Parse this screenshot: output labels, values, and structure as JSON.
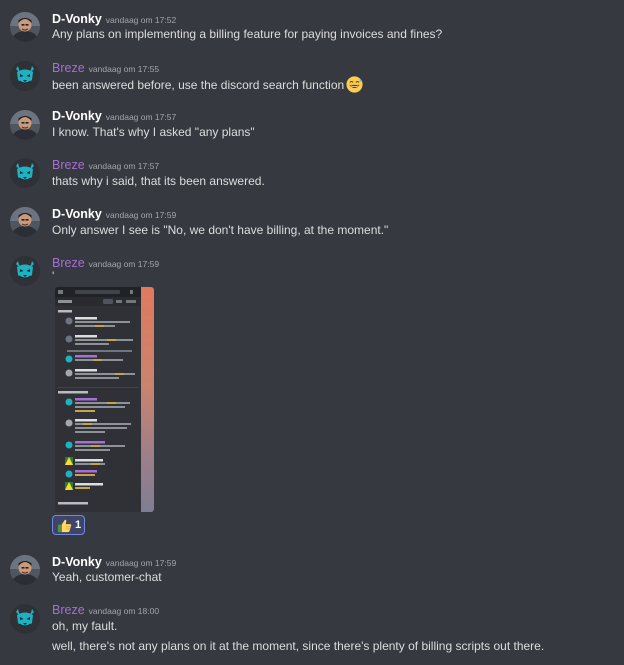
{
  "users": {
    "dvonky": "D-Vonky",
    "breze": "Breze"
  },
  "messages": [
    {
      "author": "D-Vonky",
      "time": "vandaag om 17:52",
      "text": "Any plans on implementing a billing feature for paying invoices and fines?"
    },
    {
      "author": "Breze",
      "time": "vandaag om 17:55",
      "text": "been answered before, use the discord search function",
      "emoji": "grinning-sweat-emoji"
    },
    {
      "author": "D-Vonky",
      "time": "vandaag om 17:57",
      "text": "I know. That's why I asked \"any plans\""
    },
    {
      "author": "Breze",
      "time": "vandaag om 17:57",
      "text": "thats why i said, that its been answered."
    },
    {
      "author": "D-Vonky",
      "time": "vandaag om 17:59",
      "text": "Only answer I see is \"No, we don't have billing, at the moment.\""
    },
    {
      "author": "Breze",
      "time": "vandaag om 17:59",
      "text": "'",
      "attachment": "search-results-screenshot",
      "reaction": {
        "emoji": "thumbs-up-emoji",
        "count": "1"
      }
    },
    {
      "author": "D-Vonky",
      "time": "vandaag om 17:59",
      "text": "Yeah, customer-chat"
    },
    {
      "author": "Breze",
      "time": "vandaag om 18:00",
      "text": "oh, my fault.",
      "text2": "well, there's not any plans on it at the moment, since there's plenty of billing scripts out there."
    }
  ],
  "colors": {
    "background": "#36393f",
    "text": "#dcddde",
    "username_dvonky": "#ffffff",
    "username_breze": "#a56fd3",
    "timestamp": "#a3a6aa",
    "reaction_border": "#7289da",
    "reaction_bg": "#3f4569"
  }
}
